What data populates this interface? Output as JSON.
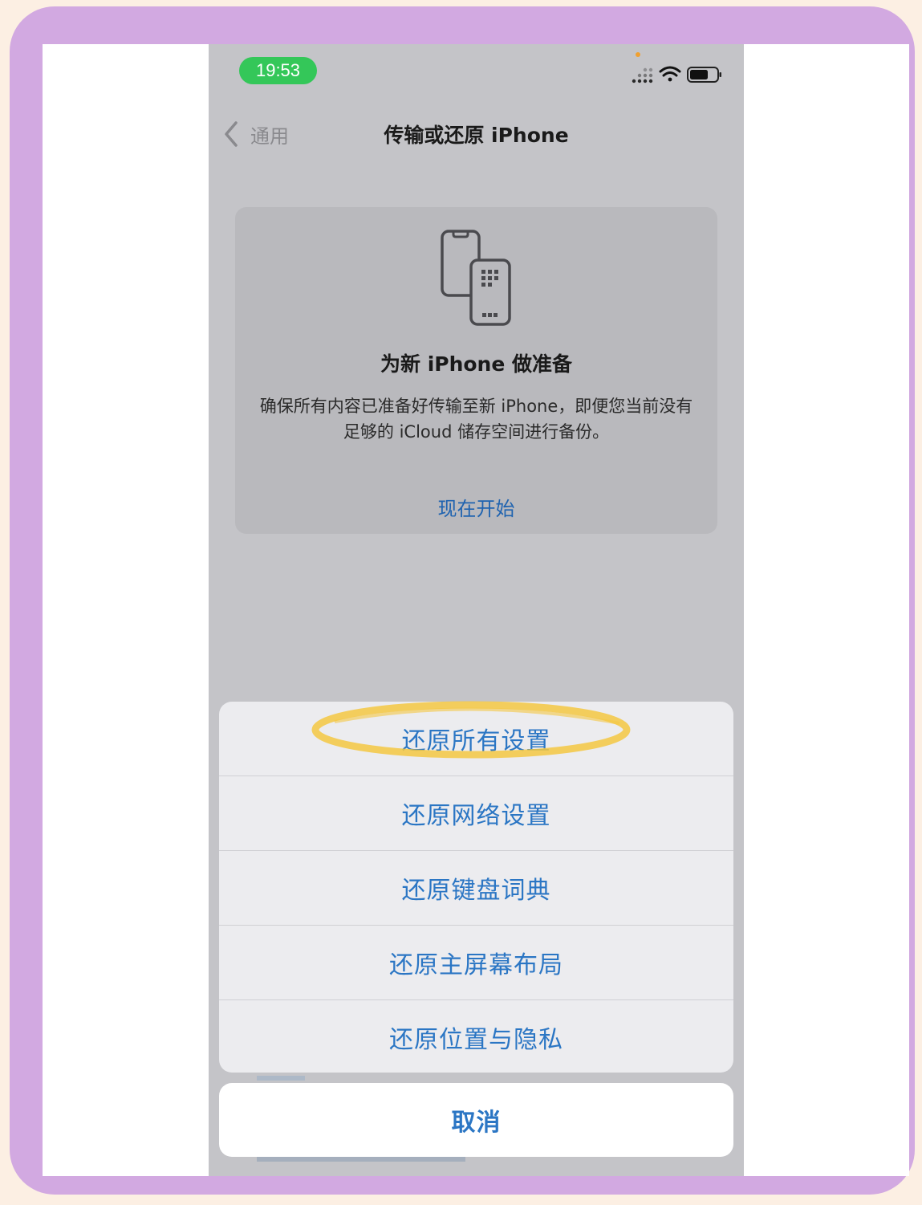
{
  "status_bar": {
    "time": "19:53"
  },
  "nav": {
    "back_label": "通用",
    "title": "传输或还原 iPhone"
  },
  "prepare_card": {
    "title": "为新 iPhone 做准备",
    "description": "确保所有内容已准备好传输至新 iPhone，即便您当前没有足够的 iCloud 储存空间进行备份。",
    "action_label": "现在开始",
    "icon": "phone-transfer-icon"
  },
  "action_sheet": {
    "items": [
      {
        "label": "还原所有设置",
        "highlighted": true
      },
      {
        "label": "还原网络设置"
      },
      {
        "label": "还原键盘词典"
      },
      {
        "label": "还原主屏幕布局"
      },
      {
        "label": "还原位置与隐私"
      }
    ],
    "cancel_label": "取消"
  },
  "colors": {
    "accent": "#2b76c4",
    "frame": "#d2a9e1",
    "status_time_pill": "#34c759",
    "highlight_ring": "#f5c842"
  }
}
